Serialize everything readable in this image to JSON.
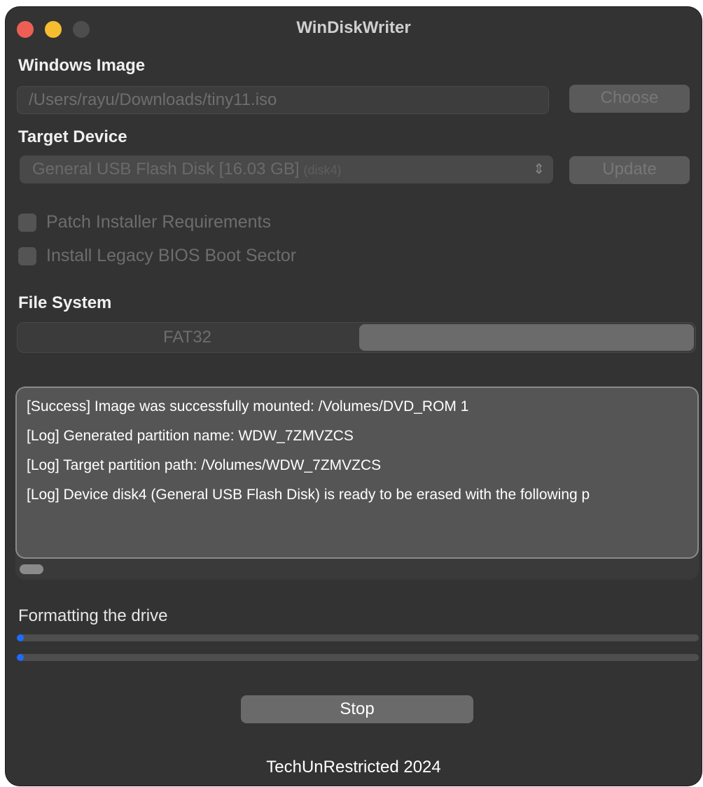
{
  "window": {
    "title": "WinDiskWriter"
  },
  "windows_image": {
    "label": "Windows Image",
    "path_value": "/Users/rayu/Downloads/tiny11.iso",
    "choose_label": "Choose"
  },
  "target_device": {
    "label": "Target Device",
    "selected_device": "General USB Flash Disk [16.03 GB]",
    "selected_device_id": "(disk4)",
    "update_label": "Update"
  },
  "options": {
    "patch_installer": {
      "label": "Patch Installer Requirements",
      "checked": false
    },
    "legacy_bios": {
      "label": "Install Legacy BIOS Boot Sector",
      "checked": false
    }
  },
  "file_system": {
    "label": "File System",
    "options": [
      "FAT32",
      ""
    ],
    "selected_index": 1
  },
  "log": {
    "lines": [
      "[Success] Image was successfully mounted: /Volumes/DVD_ROM 1",
      "[Log] Generated partition name: WDW_7ZMVZCS",
      "[Log] Target partition path: /Volumes/WDW_7ZMVZCS",
      "[Log] Device disk4 (General USB Flash Disk) is ready to be erased with the following p"
    ]
  },
  "progress": {
    "status": "Formatting the drive",
    "bar1_fraction": 0.01,
    "bar2_fraction": 0.01
  },
  "stop_label": "Stop",
  "footer": "TechUnRestricted 2024",
  "colors": {
    "window_bg": "#333333",
    "progress_fill": "#1e6cff",
    "close": "#ed5f55",
    "minimize": "#f5bd2f"
  }
}
